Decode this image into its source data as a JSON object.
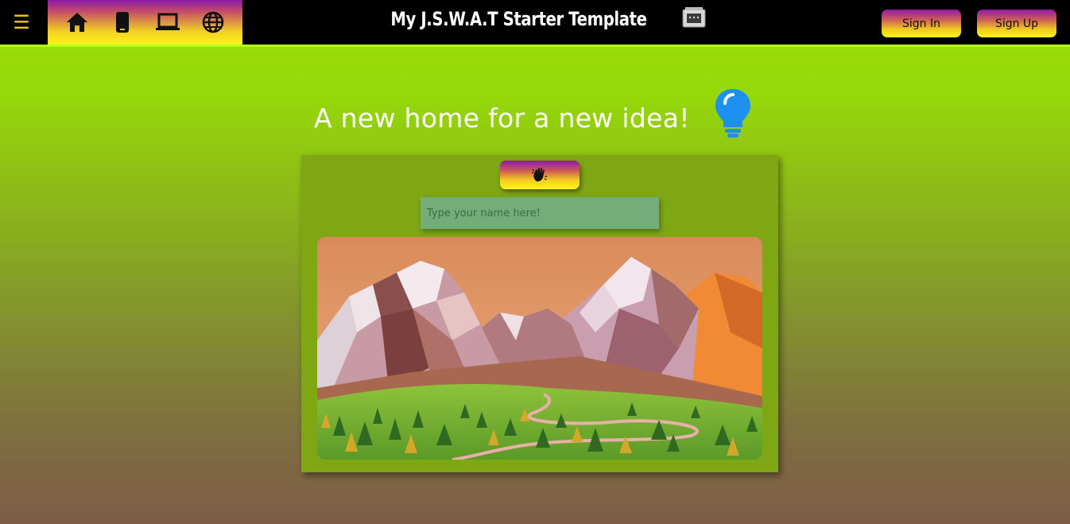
{
  "header": {
    "menu_icon": "hamburger-icon",
    "nav_icons": [
      "home-icon",
      "smartphone-icon",
      "laptop-icon",
      "globe-icon"
    ],
    "brand_title": "My J.S.W.A.T Starter Template",
    "brand_icon": "computer-chip-icon",
    "sign_in_label": "Sign In",
    "sign_up_label": "Sign Up"
  },
  "main": {
    "headline": "A new home for a new idea!",
    "headline_icon": "lightbulb-icon",
    "wave_button_icon": "waving-hand-icon",
    "name_input": {
      "placeholder": "Type your name here!",
      "value": ""
    },
    "scene_image": "low-poly-mountain-landscape"
  },
  "colors": {
    "accent_yellow": "#f0c419",
    "bulb_blue": "#1e90f0",
    "topbar": "#000000",
    "card": "#7fa714"
  }
}
